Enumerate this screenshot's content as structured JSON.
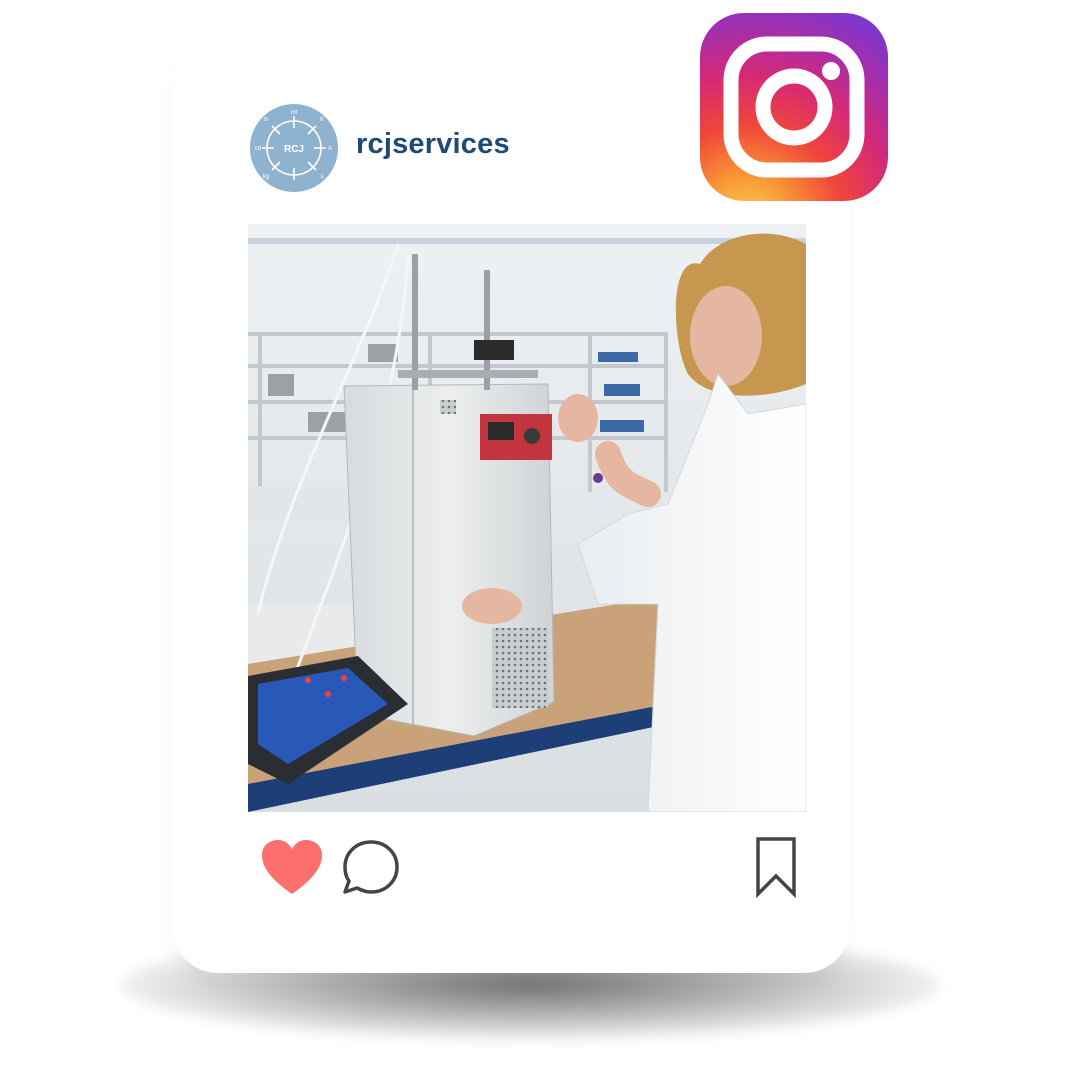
{
  "post": {
    "username": "rcjservices",
    "avatar": {
      "label": "RCJ",
      "marks": [
        "ml",
        "cd",
        "kg",
        "m",
        "A",
        "s",
        "K"
      ]
    },
    "photo_alt": "Woman in a white lab coat operating a laboratory temperature calibration bath"
  },
  "actions": {
    "like": {
      "icon": "heart-icon",
      "color": "#fb6f6e",
      "state": "liked"
    },
    "comment": {
      "icon": "comment-icon",
      "color": "#444444"
    },
    "save": {
      "icon": "bookmark-icon",
      "color": "#444444"
    }
  },
  "brand": {
    "icon": "instagram-logo-icon"
  },
  "colors": {
    "username": "#1f4a73",
    "avatar_bg": "#8fb2cf",
    "background": "#ffffff"
  }
}
